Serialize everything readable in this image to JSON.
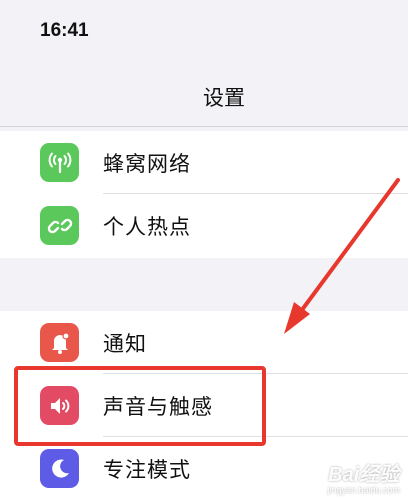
{
  "status_bar": {
    "time": "16:41"
  },
  "nav": {
    "title": "设置"
  },
  "groups": [
    {
      "items": [
        {
          "label": "蜂窝网络",
          "icon": "cellular-antenna-icon",
          "color": "#5ac85a"
        },
        {
          "label": "个人热点",
          "icon": "hotspot-link-icon",
          "color": "#5ac85a"
        }
      ]
    },
    {
      "items": [
        {
          "label": "通知",
          "icon": "bell-icon",
          "color": "#e9574a"
        },
        {
          "label": "声音与触感",
          "icon": "speaker-icon",
          "color": "#e34a64"
        },
        {
          "label": "专注模式",
          "icon": "moon-icon",
          "color": "#5e5ce6"
        }
      ]
    }
  ],
  "annotation": {
    "highlight_color": "#e8382e"
  },
  "watermark": {
    "top": "Bai经验",
    "bottom": "jingyan.baidu.com"
  }
}
